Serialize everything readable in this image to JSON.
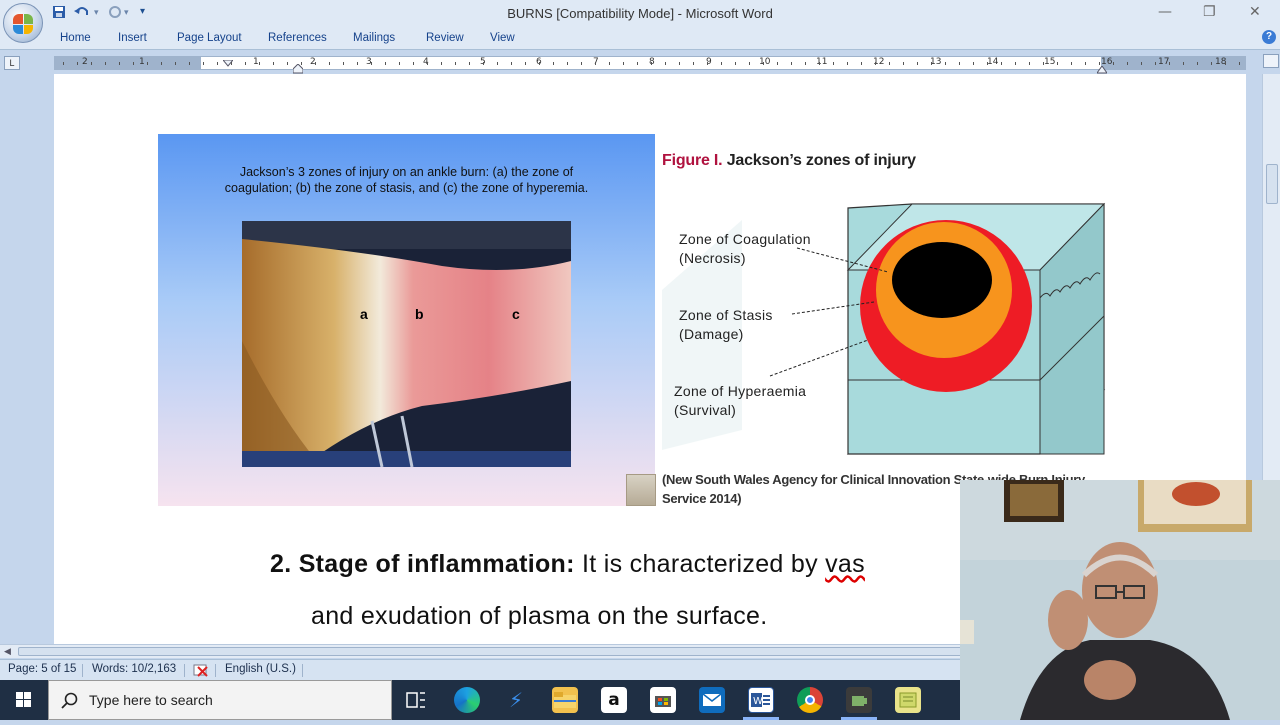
{
  "window": {
    "title": "BURNS [Compatibility Mode] - Microsoft Word",
    "controls": {
      "minimize": "—",
      "restore": "❐",
      "close": "✕"
    }
  },
  "quick_access": {
    "save_icon": "save-icon",
    "undo_icon": "undo-icon",
    "redo_icon": "redo-icon",
    "customize": "▾"
  },
  "ribbon": {
    "tabs": [
      "Home",
      "Insert",
      "Page Layout",
      "References",
      "Mailings",
      "Review",
      "View"
    ],
    "help": "?"
  },
  "ruler": {
    "tab_selector": "L",
    "numbers": [
      "2",
      "1",
      "1",
      "2",
      "3",
      "4",
      "5",
      "6",
      "7",
      "8",
      "9",
      "10",
      "11",
      "12",
      "13",
      "14",
      "15",
      "16",
      "17",
      "18"
    ]
  },
  "document": {
    "left_figure": {
      "caption_line1": "Jackson’s 3 zones of injury on an ankle burn: (a) the zone of",
      "caption_line2": "coagulation; (b) the zone of stasis, and (c) the zone of hyperemia.",
      "photo_labels": [
        "a",
        "b",
        "c"
      ]
    },
    "right_figure": {
      "figure_label": "Figure I.",
      "title": "Jackson’s zones of injury",
      "zones": [
        {
          "line1": "Zone of Coagulation",
          "line2": "(Necrosis)"
        },
        {
          "line1": "Zone of Stasis",
          "line2": "(Damage)"
        },
        {
          "line1": "Zone of Hyperaemia",
          "line2": "(Survival)"
        }
      ],
      "credit_line1": "(New South Wales Agency for Clinical Innovation State-wide Burn Injury",
      "credit_line2": "Service 2014)",
      "colors": {
        "coagulation": "#000000",
        "stasis": "#f7941d",
        "hyperaemia": "#ee1c25",
        "tissue": "#a8dadc"
      }
    },
    "body": {
      "heading": "2. Stage of inflammation:",
      "line1_text_a": " It is   characterized by ",
      "line1_text_b": "vas",
      "line2": "and exudation of plasma on the surface."
    }
  },
  "status_bar": {
    "page": "Page: 5 of 15",
    "words": "Words: 10/2,163",
    "language": "English (U.S.)"
  },
  "taskbar": {
    "search_placeholder": "Type here to search",
    "apps": [
      "task-view-icon",
      "edge-icon",
      "azure-data-icon",
      "file-explorer-icon",
      "amazon-icon",
      "store-icon",
      "mail-icon",
      "word-icon",
      "chrome-icon",
      "camera-app-icon",
      "notes-icon"
    ]
  }
}
